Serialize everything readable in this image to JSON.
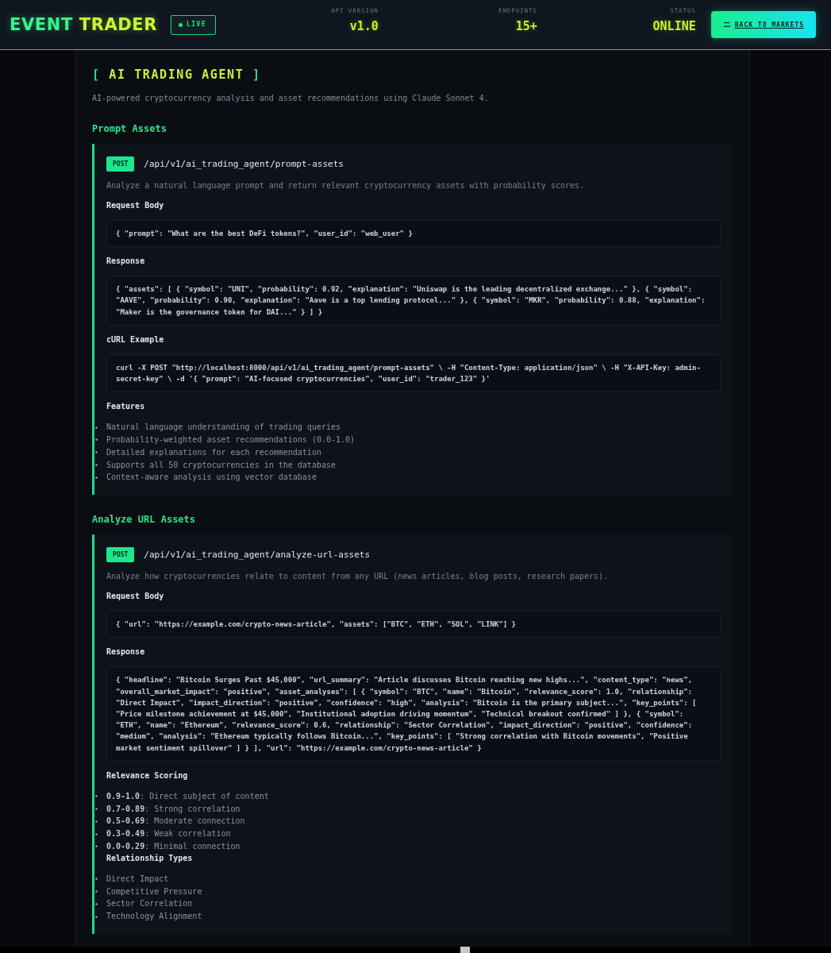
{
  "header": {
    "logo": {
      "part_1": "EVENT",
      "part_2": "TRADER"
    },
    "live_badge": {
      "label": "LIVE"
    },
    "stats": [
      {
        "label": "API VERSION",
        "value": "v1.0"
      },
      {
        "label": "ENDPOINTS",
        "value": "15+"
      },
      {
        "label": "STATUS",
        "value": "ONLINE"
      }
    ],
    "back_button": {
      "label": "BACK TO MARKETS"
    }
  },
  "page": {
    "title": {
      "open": "[",
      "text": "AI TRADING AGENT",
      "close": "]"
    },
    "description": "AI-powered cryptocurrency analysis and asset recommendations using Claude Sonnet 4."
  },
  "sections": [
    {
      "heading": "Prompt Assets",
      "endpoint": {
        "method": "POST",
        "path": "/api/v1/ai_trading_agent/prompt-assets",
        "description": "Analyze a natural language prompt and return relevant cryptocurrency assets with probability scores.",
        "blocks": [
          {
            "kind": "code",
            "heading": "Request Body",
            "code": "{ \"prompt\": \"What are the best DeFi tokens?\", \"user_id\": \"web_user\" }"
          },
          {
            "kind": "code",
            "heading": "Response",
            "code": "{ \"assets\": [ { \"symbol\": \"UNI\", \"probability\": 0.92, \"explanation\": \"Uniswap is the leading decentralized exchange...\" }, { \"symbol\": \"AAVE\", \"probability\": 0.90, \"explanation\": \"Aave is a top lending protocol...\" }, { \"symbol\": \"MKR\", \"probability\": 0.88, \"explanation\": \"Maker is the governance token for DAI...\" } ] }"
          },
          {
            "kind": "code",
            "heading": "cURL Example",
            "code": "curl -X POST \"http://localhost:8000/api/v1/ai_trading_agent/prompt-assets\" \\ -H \"Content-Type: application/json\" \\ -H \"X-API-Key: admin-secret-key\" \\ -d '{ \"prompt\": \"AI-focused cryptocurrencies\", \"user_id\": \"trader_123\" }'"
          },
          {
            "kind": "list",
            "heading": "Features",
            "items": [
              "Natural language understanding of trading queries",
              "Probability-weighted asset recommendations (0.0-1.0)",
              "Detailed explanations for each recommendation",
              "Supports all 50 cryptocurrencies in the database",
              "Context-aware analysis using vector database"
            ]
          }
        ]
      }
    },
    {
      "heading": "Analyze URL Assets",
      "endpoint": {
        "method": "POST",
        "path": "/api/v1/ai_trading_agent/analyze-url-assets",
        "description": "Analyze how cryptocurrencies relate to content from any URL (news articles, blog posts, research papers).",
        "blocks": [
          {
            "kind": "code",
            "heading": "Request Body",
            "code": "{ \"url\": \"https://example.com/crypto-news-article\", \"assets\": [\"BTC\", \"ETH\", \"SOL\", \"LINK\"] }"
          },
          {
            "kind": "code",
            "heading": "Response",
            "code": "{ \"headline\": \"Bitcoin Surges Past $45,000\", \"url_summary\": \"Article discusses Bitcoin reaching new highs...\", \"content_type\": \"news\", \"overall_market_impact\": \"positive\", \"asset_analyses\": [ { \"symbol\": \"BTC\", \"name\": \"Bitcoin\", \"relevance_score\": 1.0, \"relationship\": \"Direct Impact\", \"impact_direction\": \"positive\", \"confidence\": \"high\", \"analysis\": \"Bitcoin is the primary subject...\", \"key_points\": [ \"Price milestone achievement at $45,000\", \"Institutional adoption driving momentum\", \"Technical breakout confirmed\" ] }, { \"symbol\": \"ETH\", \"name\": \"Ethereum\", \"relevance_score\": 0.6, \"relationship\": \"Sector Correlation\", \"impact_direction\": \"positive\", \"confidence\": \"medium\", \"analysis\": \"Ethereum typically follows Bitcoin...\", \"key_points\": [ \"Strong correlation with Bitcoin movements\", \"Positive market sentiment spillover\" ] } ], \"url\": \"https://example.com/crypto-news-article\" }"
          },
          {
            "kind": "list",
            "heading": "Relevance Scoring",
            "items": [
              "**0.9-1.0**: Direct subject of content",
              "**0.7-0.89**: Strong correlation",
              "**0.5-0.69**: Moderate connection",
              "**0.3-0.49**: Weak correlation",
              "**0.0-0.29**: Minimal connection"
            ]
          },
          {
            "kind": "list",
            "heading": "Relationship Types",
            "items": [
              "Direct Impact",
              "Competitive Pressure",
              "Sector Correlation",
              "Technology Alignment"
            ]
          }
        ]
      }
    }
  ]
}
